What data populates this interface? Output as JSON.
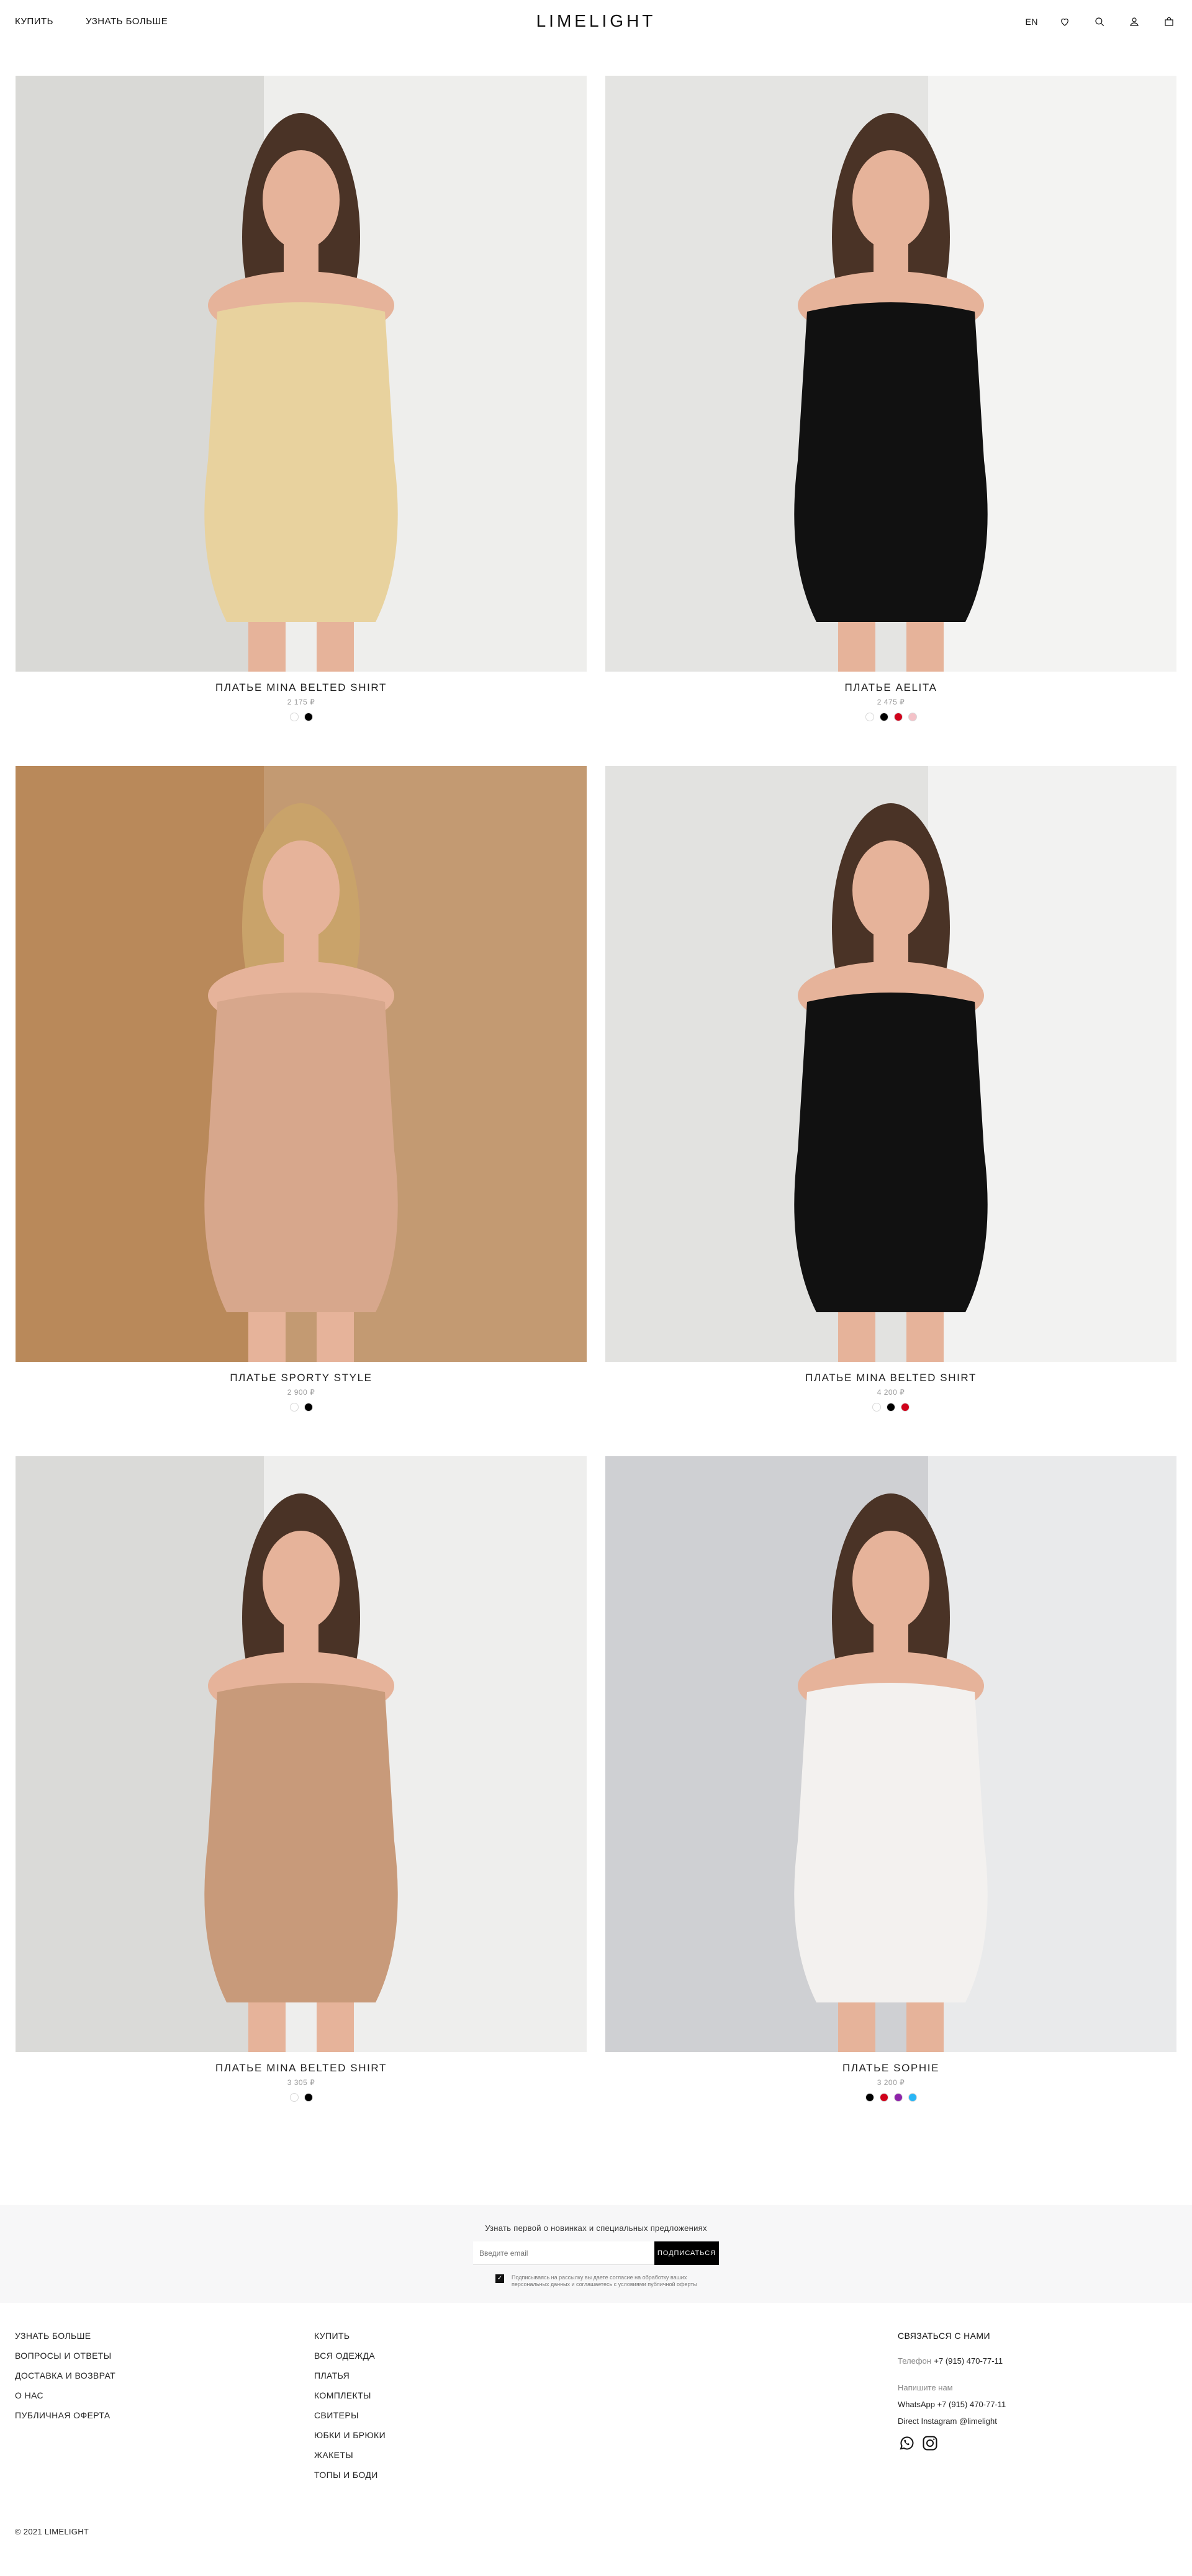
{
  "header": {
    "nav_left": [
      "КУПИТЬ",
      "УЗНАТЬ БОЛЬШЕ"
    ],
    "logo": "LIMELIGHT",
    "lang": "EN",
    "icons": [
      "heart-icon",
      "search-icon",
      "user-icon",
      "bag-icon"
    ]
  },
  "products": [
    {
      "title": "ПЛАТЬЕ MINA BELTED SHIRT",
      "price": "2 175 ₽",
      "colors": [
        "#ffffff",
        "#000000"
      ],
      "dress_color": "#e8d29e",
      "bg": "#d9d9d6"
    },
    {
      "title": "ПЛАТЬЕ AELITA",
      "price": "2 475 ₽",
      "colors": [
        "#ffffff",
        "#000000",
        "#d0021b",
        "#f4c2c8"
      ],
      "dress_color": "#111111",
      "bg": "#e4e4e2"
    },
    {
      "title": "ПЛАТЬЕ SPORTY STYLE",
      "price": "2 900 ₽",
      "colors": [
        "#ffffff",
        "#000000"
      ],
      "dress_color": "#d7a78c",
      "bg": "#b9895a"
    },
    {
      "title": "ПЛАТЬЕ MINA BELTED SHIRT",
      "price": "4 200 ₽",
      "colors": [
        "#ffffff",
        "#000000",
        "#d0021b"
      ],
      "dress_color": "#111111",
      "bg": "#e2e2e0"
    },
    {
      "title": "ПЛАТЬЕ MINA BELTED SHIRT",
      "price": "3 305 ₽",
      "colors": [
        "#ffffff",
        "#000000"
      ],
      "dress_color": "#c89a7a",
      "bg": "#dadad8"
    },
    {
      "title": "ПЛАТЬЕ SOPHIE",
      "price": "3 200 ₽",
      "colors": [
        "#000000",
        "#d0021b",
        "#8e24aa",
        "#29b6f6"
      ],
      "dress_color": "#f3f1ef",
      "bg": "#cfd0d3"
    }
  ],
  "newsletter": {
    "title": "Узнать первой о новинках и специальных предложениях",
    "placeholder": "Введите email",
    "button": "ПОДПИСАТЬСЯ",
    "consent": "Подписываясь на рассылку вы даете согласие на обработку ваших персональных данных и соглашаетесь с условиями публичной оферты"
  },
  "footer": {
    "col1": [
      "УЗНАТЬ БОЛЬШЕ",
      "ВОПРОСЫ И ОТВЕТЫ",
      "ДОСТАВКА И ВОЗВРАТ",
      "О НАС",
      "ПУБЛИЧНАЯ ОФЕРТА"
    ],
    "col2": [
      "КУПИТЬ",
      "ВСЯ ОДЕЖДА",
      "ПЛАТЬЯ",
      "КОМПЛЕКТЫ",
      "СВИТЕРЫ",
      "ЮБКИ И БРЮКИ",
      "ЖАКЕТЫ",
      "ТОПЫ И БОДИ"
    ],
    "contact": {
      "heading": "СВЯЗАТЬСЯ С НАМИ",
      "phone_label": "Телефон",
      "phone": "+7 (915) 470-77-11",
      "write_label": "Напишите нам",
      "whatsapp": "WhatsApp +7 (915) 470-77-11",
      "instagram": "Direct Instagram @limelight",
      "social_icons": [
        "whatsapp-icon",
        "instagram-icon"
      ]
    },
    "copyright": "© 2021 LIMELIGHT"
  }
}
